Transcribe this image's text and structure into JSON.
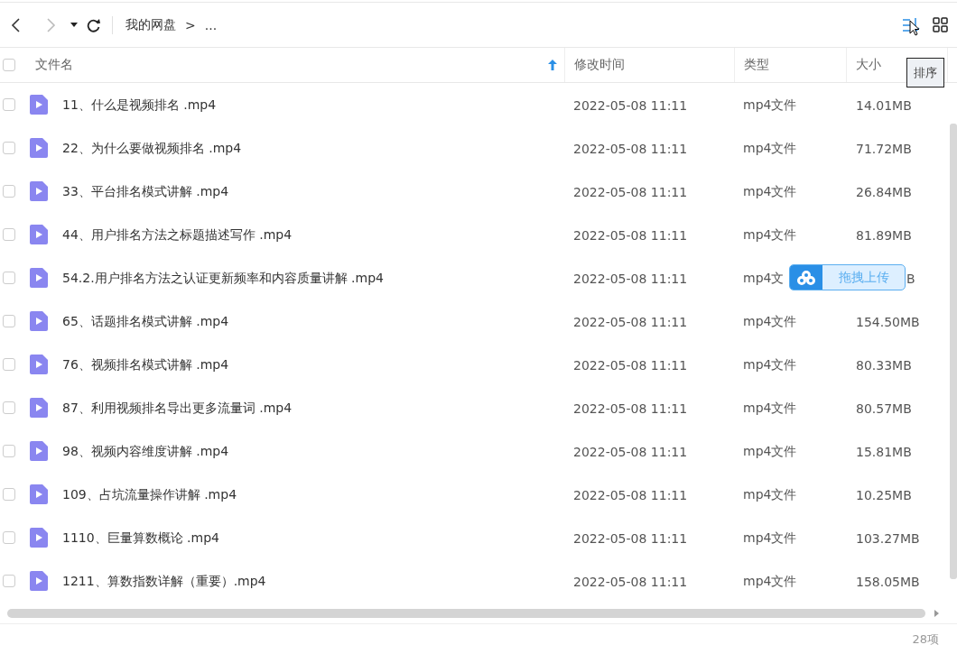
{
  "toolbar": {
    "breadcrumb": [
      "我的网盘",
      "..."
    ],
    "separator": ">",
    "forward_disabled": true
  },
  "tooltip": "排序",
  "columns": [
    {
      "label": "文件名",
      "sorted": true
    },
    {
      "label": "修改时间",
      "sorted": false
    },
    {
      "label": "类型",
      "sorted": false
    },
    {
      "label": "大小",
      "sorted": false
    }
  ],
  "header_checked": false,
  "rows": [
    {
      "name": "11、什么是视频排名 .mp4",
      "modified": "2022-05-08 11:11",
      "type": "mp4文件",
      "size": "14.01MB",
      "checked": false
    },
    {
      "name": "22、为什么要做视频排名 .mp4",
      "modified": "2022-05-08 11:11",
      "type": "mp4文件",
      "size": "71.72MB",
      "checked": false
    },
    {
      "name": "33、平台排名模式讲解 .mp4",
      "modified": "2022-05-08 11:11",
      "type": "mp4文件",
      "size": "26.84MB",
      "checked": false
    },
    {
      "name": "44、用户排名方法之标题描述写作 .mp4",
      "modified": "2022-05-08 11:11",
      "type": "mp4文件",
      "size": "81.89MB",
      "checked": false
    },
    {
      "name": "54.2.用户排名方法之认证更新频率和内容质量讲解 .mp4",
      "modified": "2022-05-08 11:11",
      "type": "mp4文",
      "size": "B",
      "checked": false,
      "overlay": true
    },
    {
      "name": "65、话题排名模式讲解 .mp4",
      "modified": "2022-05-08 11:11",
      "type": "mp4文件",
      "size": "154.50MB",
      "checked": false
    },
    {
      "name": "76、视频排名模式讲解 .mp4",
      "modified": "2022-05-08 11:11",
      "type": "mp4文件",
      "size": "80.33MB",
      "checked": false
    },
    {
      "name": "87、利用视频排名导出更多流量词 .mp4",
      "modified": "2022-05-08 11:11",
      "type": "mp4文件",
      "size": "80.57MB",
      "checked": false
    },
    {
      "name": "98、视频内容维度讲解 .mp4",
      "modified": "2022-05-08 11:11",
      "type": "mp4文件",
      "size": "15.81MB",
      "checked": false
    },
    {
      "name": "109、占坑流量操作讲解 .mp4",
      "modified": "2022-05-08 11:11",
      "type": "mp4文件",
      "size": "10.25MB",
      "checked": false
    },
    {
      "name": "1110、巨量算数概论 .mp4",
      "modified": "2022-05-08 11:11",
      "type": "mp4文件",
      "size": "103.27MB",
      "checked": false
    },
    {
      "name": "1211、算数指数详解（重要）.mp4",
      "modified": "2022-05-08 11:11",
      "type": "mp4文件",
      "size": "158.05MB",
      "checked": false
    }
  ],
  "upload_badge": "拖拽上传",
  "item_count": "28项"
}
